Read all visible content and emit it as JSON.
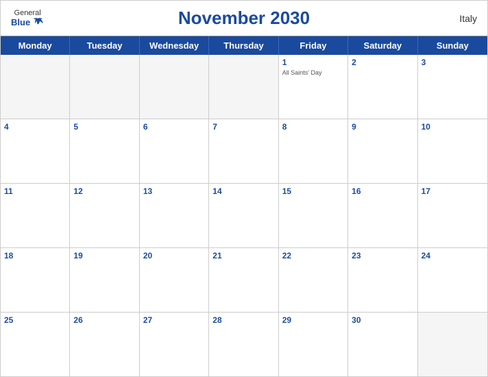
{
  "header": {
    "logo_general": "General",
    "logo_blue": "Blue",
    "title": "November 2030",
    "country": "Italy"
  },
  "day_headers": [
    "Monday",
    "Tuesday",
    "Wednesday",
    "Thursday",
    "Friday",
    "Saturday",
    "Sunday"
  ],
  "weeks": [
    [
      {
        "number": "",
        "empty": true
      },
      {
        "number": "",
        "empty": true
      },
      {
        "number": "",
        "empty": true
      },
      {
        "number": "",
        "empty": true
      },
      {
        "number": "1",
        "event": "All Saints' Day"
      },
      {
        "number": "2"
      },
      {
        "number": "3"
      }
    ],
    [
      {
        "number": "4"
      },
      {
        "number": "5"
      },
      {
        "number": "6"
      },
      {
        "number": "7"
      },
      {
        "number": "8"
      },
      {
        "number": "9"
      },
      {
        "number": "10"
      }
    ],
    [
      {
        "number": "11"
      },
      {
        "number": "12"
      },
      {
        "number": "13"
      },
      {
        "number": "14"
      },
      {
        "number": "15"
      },
      {
        "number": "16"
      },
      {
        "number": "17"
      }
    ],
    [
      {
        "number": "18"
      },
      {
        "number": "19"
      },
      {
        "number": "20"
      },
      {
        "number": "21"
      },
      {
        "number": "22"
      },
      {
        "number": "23"
      },
      {
        "number": "24"
      }
    ],
    [
      {
        "number": "25"
      },
      {
        "number": "26"
      },
      {
        "number": "27"
      },
      {
        "number": "28"
      },
      {
        "number": "29"
      },
      {
        "number": "30"
      },
      {
        "number": "",
        "empty": true
      }
    ]
  ],
  "colors": {
    "header_bg": "#1a4a9e",
    "header_text": "#ffffff",
    "day_number": "#1a4a9e",
    "event_text": "#555555"
  }
}
